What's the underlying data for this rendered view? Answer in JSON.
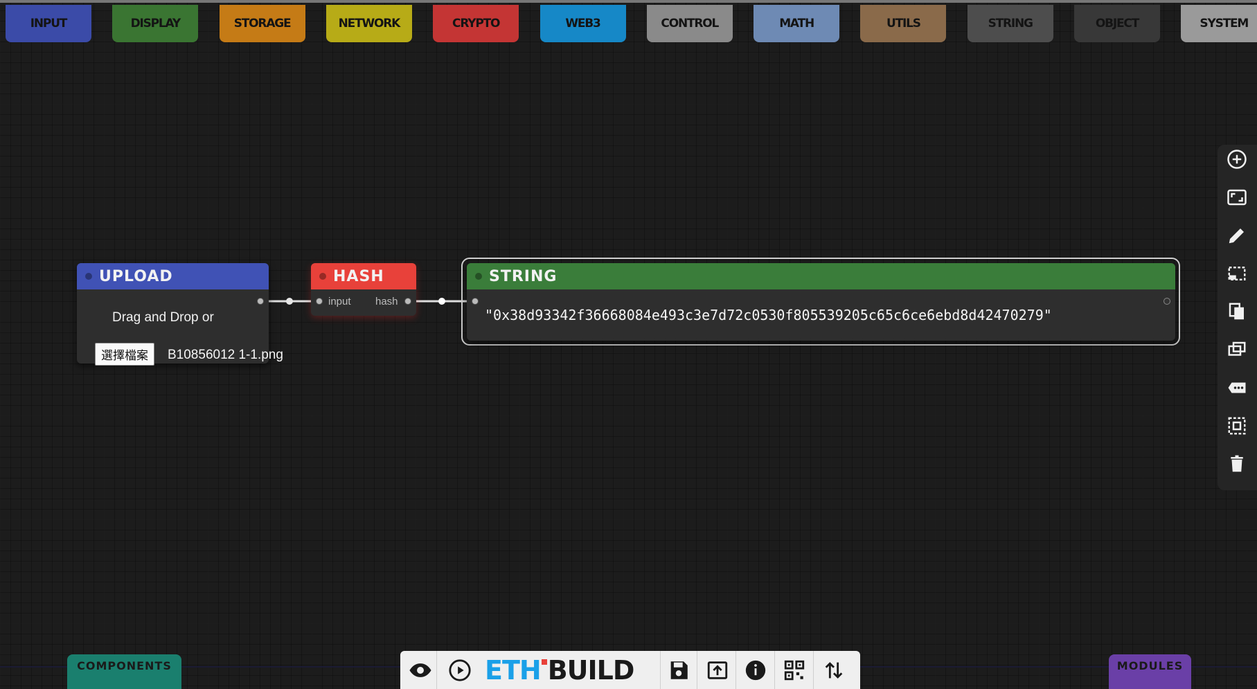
{
  "categories": [
    {
      "label": "INPUT",
      "color": "#3b4ba8"
    },
    {
      "label": "DISPLAY",
      "color": "#3a7532"
    },
    {
      "label": "STORAGE",
      "color": "#c57b16"
    },
    {
      "label": "NETWORK",
      "color": "#b7ab17"
    },
    {
      "label": "CRYPTO",
      "color": "#c43534"
    },
    {
      "label": "WEB3",
      "color": "#1688c7"
    },
    {
      "label": "CONTROL",
      "color": "#8a8a8a"
    },
    {
      "label": "MATH",
      "color": "#6e8ab4"
    },
    {
      "label": "UTILS",
      "color": "#8a6a4a"
    },
    {
      "label": "STRING",
      "color": "#4d4d4d"
    },
    {
      "label": "OBJECT",
      "color": "#383838"
    },
    {
      "label": "SYSTEM",
      "color": "#9a9a9a"
    }
  ],
  "upload_node": {
    "title": "UPLOAD",
    "color": "#4052b5",
    "text": "Drag and Drop or",
    "file_button": "選擇檔案",
    "file_name": "B10856012 1-1.png"
  },
  "hash_node": {
    "title": "HASH",
    "color": "#e8413a",
    "input_label": "input",
    "output_label": "hash"
  },
  "string_node": {
    "title": "STRING",
    "color": "#3a7d3a",
    "value": "\"0x38d93342f36668084e493c3e7d72c0530f805539205c65c6ce6ebd8d42470279\""
  },
  "right_toolbar": {
    "icons": [
      "add-circle-icon",
      "fit-screen-icon",
      "edit-pencil-icon",
      "select-area-icon",
      "copy-icon",
      "duplicate-icon",
      "comment-icon",
      "select-all-icon",
      "trash-icon"
    ]
  },
  "bottom": {
    "components_label": "COMPONENTS",
    "modules_label": "MODULES",
    "components_color": "#1a7f6e",
    "modules_color": "#6a3fa7",
    "logo_eth": "ETH",
    "logo_build": "BUILD",
    "icons": [
      "eye-icon",
      "play-icon",
      "save-icon",
      "load-icon",
      "info-icon",
      "qr-icon",
      "swap-icon"
    ]
  }
}
